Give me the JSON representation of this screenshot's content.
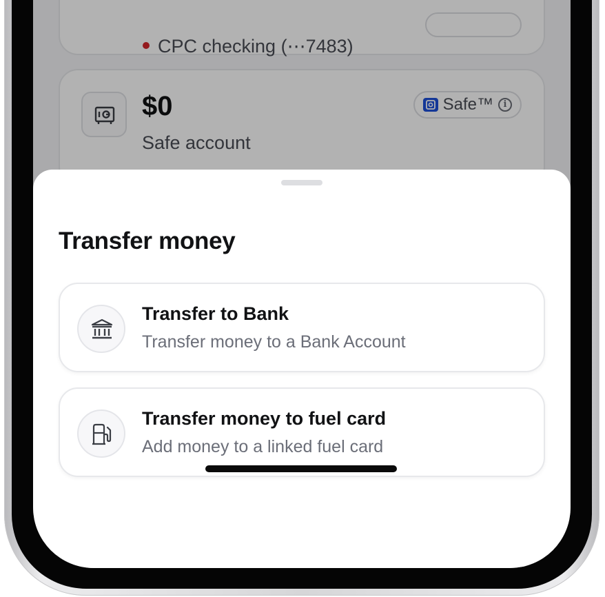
{
  "background": {
    "checking_account": "CPC checking (⋯7483)",
    "safe_card": {
      "amount": "$0",
      "label": "Safe account",
      "pill_text": "Safe™",
      "pill_logo_icon": "safe-brand-logo-icon",
      "info_icon": "info-icon"
    },
    "status_dot_color": "#d4262b",
    "brand_color": "#1d4fd8"
  },
  "sheet": {
    "title": "Transfer money",
    "options": [
      {
        "icon": "bank-icon",
        "title": "Transfer to Bank",
        "subtitle": "Transfer money to a Bank Account"
      },
      {
        "icon": "fuel-pump-icon",
        "title": "Transfer money to fuel card",
        "subtitle": "Add money to a linked fuel card"
      }
    ]
  }
}
